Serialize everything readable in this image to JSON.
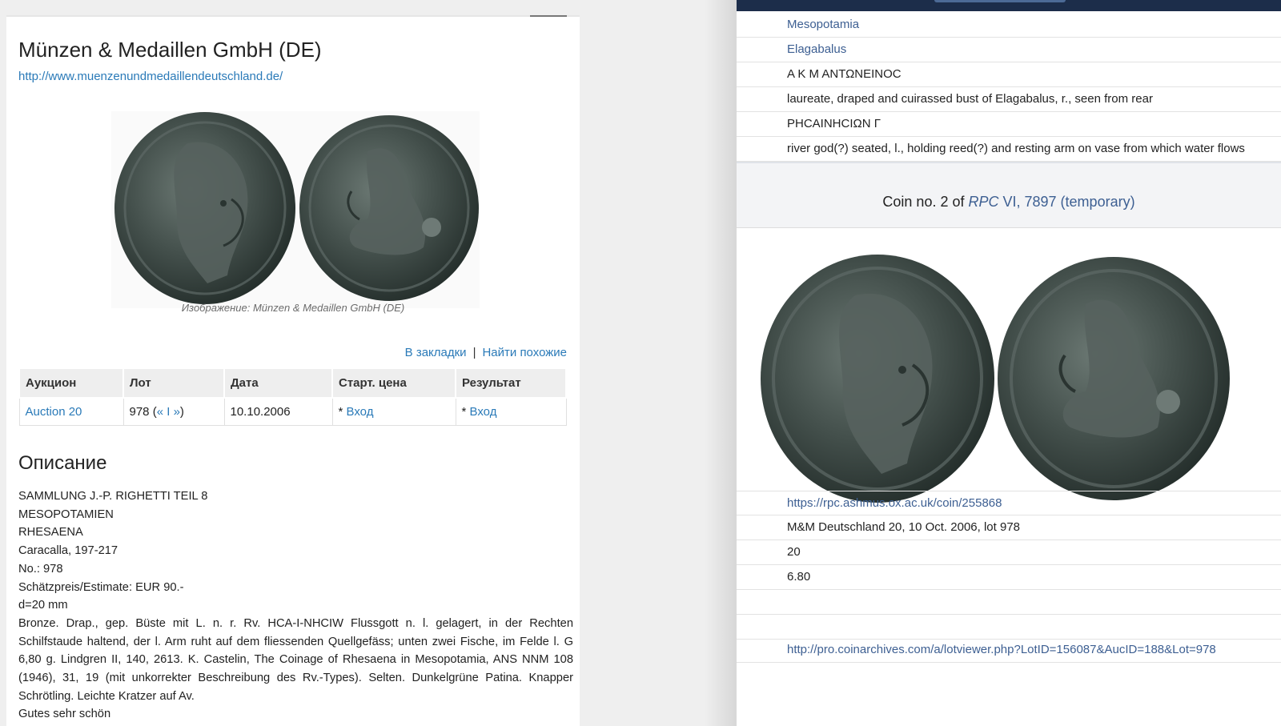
{
  "left": {
    "title": "Münzen & Medaillen GmbH (DE)",
    "url": "http://www.muenzenundmedaillendeutschland.de/",
    "image_caption": "Изображение: Münzen & Medaillen GmbH (DE)",
    "actions": {
      "bookmark": "В закладки",
      "separator": "|",
      "find_similar": "Найти похожие"
    },
    "table": {
      "headers": [
        "Аукцион",
        "Лот",
        "Дата",
        "Старт. цена",
        "Результат"
      ],
      "row": {
        "auction": "Auction 20",
        "lot_number": "978 (",
        "lot_prev": "«",
        "lot_sep": " I ",
        "lot_next": "»",
        "lot_close": ")",
        "date": "10.10.2006",
        "start_prefix": "* ",
        "start_link": "Вход",
        "result_prefix": "* ",
        "result_link": "Вход"
      }
    },
    "description_heading": "Описание",
    "description_lines": [
      "SAMMLUNG J.-P. RIGHETTI TEIL 8",
      "MESOPOTAMIEN",
      "RHESAENA",
      "Caracalla, 197-217",
      "No.: 978",
      "Schätzpreis/Estimate: EUR 90.-",
      "d=20 mm"
    ],
    "description_paragraph": "Bronze. Drap., gep. Büste mit L. n. r. Rv. HCA-I-NHCIW Flussgott n. l. gelagert, in der Rechten Schilfstaude haltend, der l. Arm ruht auf dem fliessenden Quellgefäss; unten zwei Fische, im Felde l. G 6,80 g. Lindgren II, 140, 2613. K. Castelin, The Coinage of Rhesaena in Mesopotamia, ANS NNM 108 (1946), 31, 19 (mit unkorrekter Beschreibung des Rv.-Types). Selten. Dunkelgrüne Patina. Knapper Schrötling. Leichte Kratzer auf Av.",
    "description_last": "Gutes sehr schön"
  },
  "right": {
    "rows_top": [
      "Mesopotamia",
      "Elagabalus",
      "Α Κ Μ ΑΝΤΩΝΕΙΝΟϹ",
      "laureate, draped and cuirassed bust of Elagabalus, r., seen from rear",
      "ΡΗϹΑΙΝΗϹΙΩΝ Γ",
      "river god(?) seated, l., holding reed(?) and resting arm on vase from which water flows"
    ],
    "coin_heading_prefix": "Coin no. 2 of ",
    "coin_heading_rpc": "RPC",
    "coin_heading_link_rest": " VI, 7897 (temporary)",
    "rows_bottom": [
      "https://rpc.ashmus.ox.ac.uk/coin/255868",
      "M&M Deutschland 20, 10 Oct. 2006, lot 978",
      "20",
      "6.80",
      "",
      "",
      "http://pro.coinarchives.com/a/lotviewer.php?LotID=156087&AucID=188&Lot=978"
    ]
  },
  "colors": {
    "left_link": "#2a7ab8",
    "right_link": "#3d5f92",
    "right_topbar": "#1c2d4a",
    "coin_patina": "#3f4b47"
  }
}
